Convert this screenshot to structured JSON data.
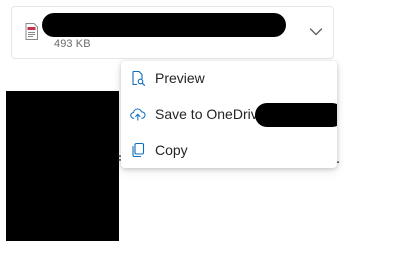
{
  "attachment": {
    "file_size": "493 KB",
    "file_type_icon": "pdf-file-icon",
    "expand_icon": "chevron-down-icon"
  },
  "background_text": {
    "fragment": "=",
    "tail": "."
  },
  "context_menu": {
    "items": [
      {
        "label": "Preview",
        "icon": "preview-icon"
      },
      {
        "label": "Save to OneDriv",
        "icon": "cloud-upload-icon"
      },
      {
        "label": "Copy",
        "icon": "copy-icon"
      }
    ]
  },
  "colors": {
    "accent": "#0f6cbd",
    "pdf_red": "#c4314b",
    "menu_text": "#242424",
    "meta_text": "#6b6b6b"
  }
}
